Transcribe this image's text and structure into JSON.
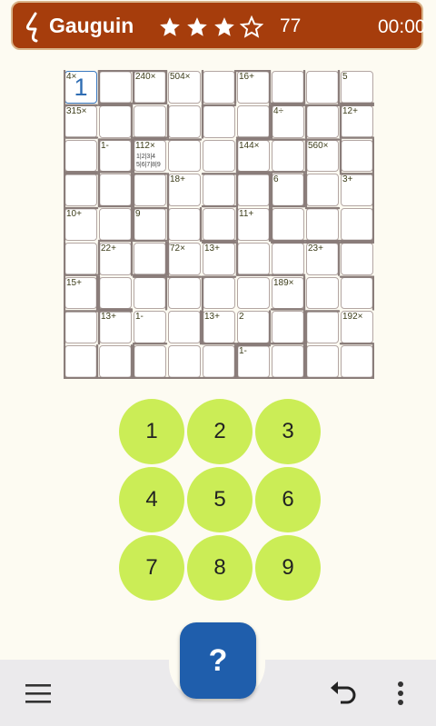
{
  "header": {
    "title": "Gauguin",
    "rating": 3,
    "rating_max": 4,
    "score": "77",
    "timer": "00:00",
    "bg_color": "#a63d0c"
  },
  "grid": {
    "size": 9,
    "cages": [
      [
        0,
        0,
        0,
        1
      ],
      [
        1,
        0,
        1,
        1
      ],
      [
        1,
        1,
        1,
        1
      ],
      [
        0,
        0,
        0,
        0
      ],
      [
        0,
        1,
        0,
        1
      ],
      [
        1,
        1,
        0,
        0
      ],
      [
        0,
        1,
        1,
        0
      ],
      [
        0,
        1,
        0,
        0
      ],
      [
        0,
        0,
        1,
        0
      ],
      [
        1,
        0,
        1,
        1
      ],
      [
        1,
        1,
        0,
        0
      ],
      [
        0,
        0,
        1,
        0
      ],
      [
        0,
        0,
        0,
        1
      ],
      [
        1,
        0,
        0,
        1
      ],
      [
        0,
        1,
        1,
        0
      ],
      [
        1,
        0,
        0,
        1
      ],
      [
        1,
        0,
        0,
        1
      ],
      [
        1,
        0,
        1,
        1
      ],
      [
        0,
        0,
        1,
        1
      ],
      [
        1,
        1,
        1,
        1
      ],
      [
        1,
        0,
        0,
        1
      ],
      [
        1,
        0,
        0,
        0
      ],
      [
        0,
        0,
        0,
        0
      ],
      [
        1,
        0,
        1,
        1
      ],
      [
        1,
        0,
        1,
        0
      ],
      [
        1,
        0,
        0,
        1
      ],
      [
        0,
        1,
        0,
        1
      ],
      [
        1,
        0,
        0,
        1
      ],
      [
        0,
        1,
        1,
        1
      ],
      [
        1,
        0,
        0,
        1
      ],
      [
        0,
        0,
        0,
        1
      ],
      [
        1,
        0,
        1,
        0
      ],
      [
        1,
        1,
        0,
        1
      ],
      [
        0,
        1,
        1,
        1
      ],
      [
        0,
        0,
        0,
        1
      ],
      [
        1,
        1,
        0,
        0
      ],
      [
        1,
        0,
        0,
        1
      ],
      [
        0,
        1,
        1,
        0
      ],
      [
        1,
        0,
        1,
        1
      ],
      [
        0,
        1,
        0,
        1
      ],
      [
        0,
        0,
        1,
        0
      ],
      [
        0,
        1,
        0,
        1
      ],
      [
        0,
        0,
        1,
        1
      ],
      [
        1,
        0,
        1,
        0
      ],
      [
        0,
        1,
        1,
        0
      ],
      [
        0,
        0,
        1,
        1
      ],
      [
        0,
        1,
        0,
        1
      ],
      [
        0,
        1,
        1,
        0
      ],
      [
        0,
        0,
        0,
        1
      ],
      [
        1,
        0,
        0,
        0
      ],
      [
        0,
        0,
        1,
        1
      ],
      [
        1,
        0,
        1,
        0
      ],
      [
        1,
        1,
        0,
        0
      ],
      [
        1,
        0,
        0,
        0
      ],
      [
        0,
        1,
        0,
        1
      ],
      [
        0,
        0,
        1,
        1
      ],
      [
        1,
        1,
        0,
        0
      ],
      [
        1,
        0,
        0,
        0
      ],
      [
        1,
        0,
        0,
        1
      ],
      [
        0,
        0,
        0,
        0
      ],
      [
        0,
        1,
        1,
        0
      ],
      [
        0,
        0,
        0,
        0
      ],
      [
        1,
        1,
        0,
        0
      ],
      [
        1,
        0,
        0,
        1
      ],
      [
        1,
        0,
        0,
        1
      ],
      [
        0,
        0,
        1,
        0
      ],
      [
        0,
        1,
        0,
        0
      ],
      [
        0,
        0,
        1,
        1
      ],
      [
        0,
        1,
        1,
        0
      ],
      [
        0,
        1,
        1,
        0
      ],
      [
        1,
        0,
        0,
        1
      ],
      [
        0,
        0,
        1,
        0
      ],
      [
        0,
        1,
        1,
        1
      ],
      [
        0,
        1,
        1,
        0
      ],
      [
        0,
        0,
        1,
        1
      ],
      [
        0,
        0,
        1,
        0
      ],
      [
        0,
        1,
        1,
        0
      ],
      [
        1,
        0,
        1,
        1
      ],
      [
        0,
        1,
        1,
        0
      ],
      [
        0,
        0,
        1,
        1
      ],
      [
        0,
        1,
        1,
        0
      ]
    ],
    "clues": [
      {
        "cell": 0,
        "text": "4×"
      },
      {
        "cell": 2,
        "text": "240×"
      },
      {
        "cell": 3,
        "text": "504×"
      },
      {
        "cell": 5,
        "text": "16+"
      },
      {
        "cell": 8,
        "text": "5"
      },
      {
        "cell": 9,
        "text": "315×"
      },
      {
        "cell": 15,
        "text": "4÷"
      },
      {
        "cell": 17,
        "text": "12+"
      },
      {
        "cell": 19,
        "text": "1-"
      },
      {
        "cell": 20,
        "text": "112×"
      },
      {
        "cell": 23,
        "text": "144×"
      },
      {
        "cell": 25,
        "text": "560×"
      },
      {
        "cell": 30,
        "text": "18+"
      },
      {
        "cell": 33,
        "text": "6"
      },
      {
        "cell": 35,
        "text": "3+"
      },
      {
        "cell": 36,
        "text": "10+"
      },
      {
        "cell": 38,
        "text": "9"
      },
      {
        "cell": 41,
        "text": "11+"
      },
      {
        "cell": 46,
        "text": "22+"
      },
      {
        "cell": 48,
        "text": "72×"
      },
      {
        "cell": 49,
        "text": "13+"
      },
      {
        "cell": 52,
        "text": "23+"
      },
      {
        "cell": 54,
        "text": "15+"
      },
      {
        "cell": 60,
        "text": "189×"
      },
      {
        "cell": 64,
        "text": "13+"
      },
      {
        "cell": 65,
        "text": "1-"
      },
      {
        "cell": 67,
        "text": "13+"
      },
      {
        "cell": 68,
        "text": "2"
      },
      {
        "cell": 71,
        "text": "192×"
      },
      {
        "cell": 77,
        "text": "1-"
      }
    ],
    "values": [
      {
        "cell": 0,
        "text": "1"
      }
    ],
    "notes": [
      {
        "cell": 20,
        "line1": "1|2|3|4",
        "line2": "5|6|7|8|9"
      }
    ],
    "selected_cell": 0
  },
  "keypad": {
    "keys": [
      "1",
      "2",
      "3",
      "4",
      "5",
      "6",
      "7",
      "8",
      "9"
    ],
    "color": "#cbed56"
  },
  "help_button": {
    "label": "?",
    "color": "#1f5eac"
  },
  "bottom_bar": {
    "menu_icon": "hamburger-menu-icon",
    "undo_icon": "undo-icon",
    "more_icon": "more-vertical-icon"
  }
}
